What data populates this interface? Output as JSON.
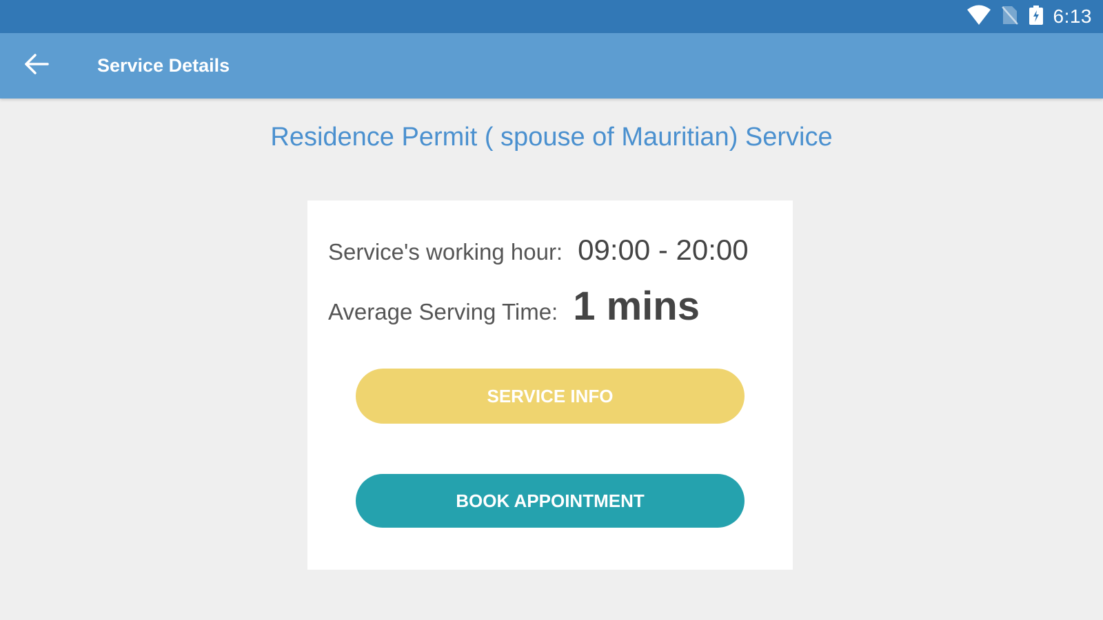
{
  "status_bar": {
    "time": "6:13",
    "icons": [
      "wifi-icon",
      "no-sim-icon",
      "battery-charging-icon"
    ],
    "color": "#3278b6"
  },
  "app_bar": {
    "back_icon": "arrow-left-icon",
    "title": "Service Details",
    "color": "#5d9dd1"
  },
  "service": {
    "title": "Residence Permit ( spouse of Mauritian) Service",
    "working_hour_label": "Service's working hour:",
    "working_hour_value": "09:00 - 20:00",
    "avg_time_label": "Average Serving Time:",
    "avg_time_value": "1 mins"
  },
  "buttons": {
    "service_info_label": "SERVICE INFO",
    "service_info_color": "#efd46f",
    "book_label": "BOOK APPOINTMENT",
    "book_color": "#25a2ae"
  }
}
